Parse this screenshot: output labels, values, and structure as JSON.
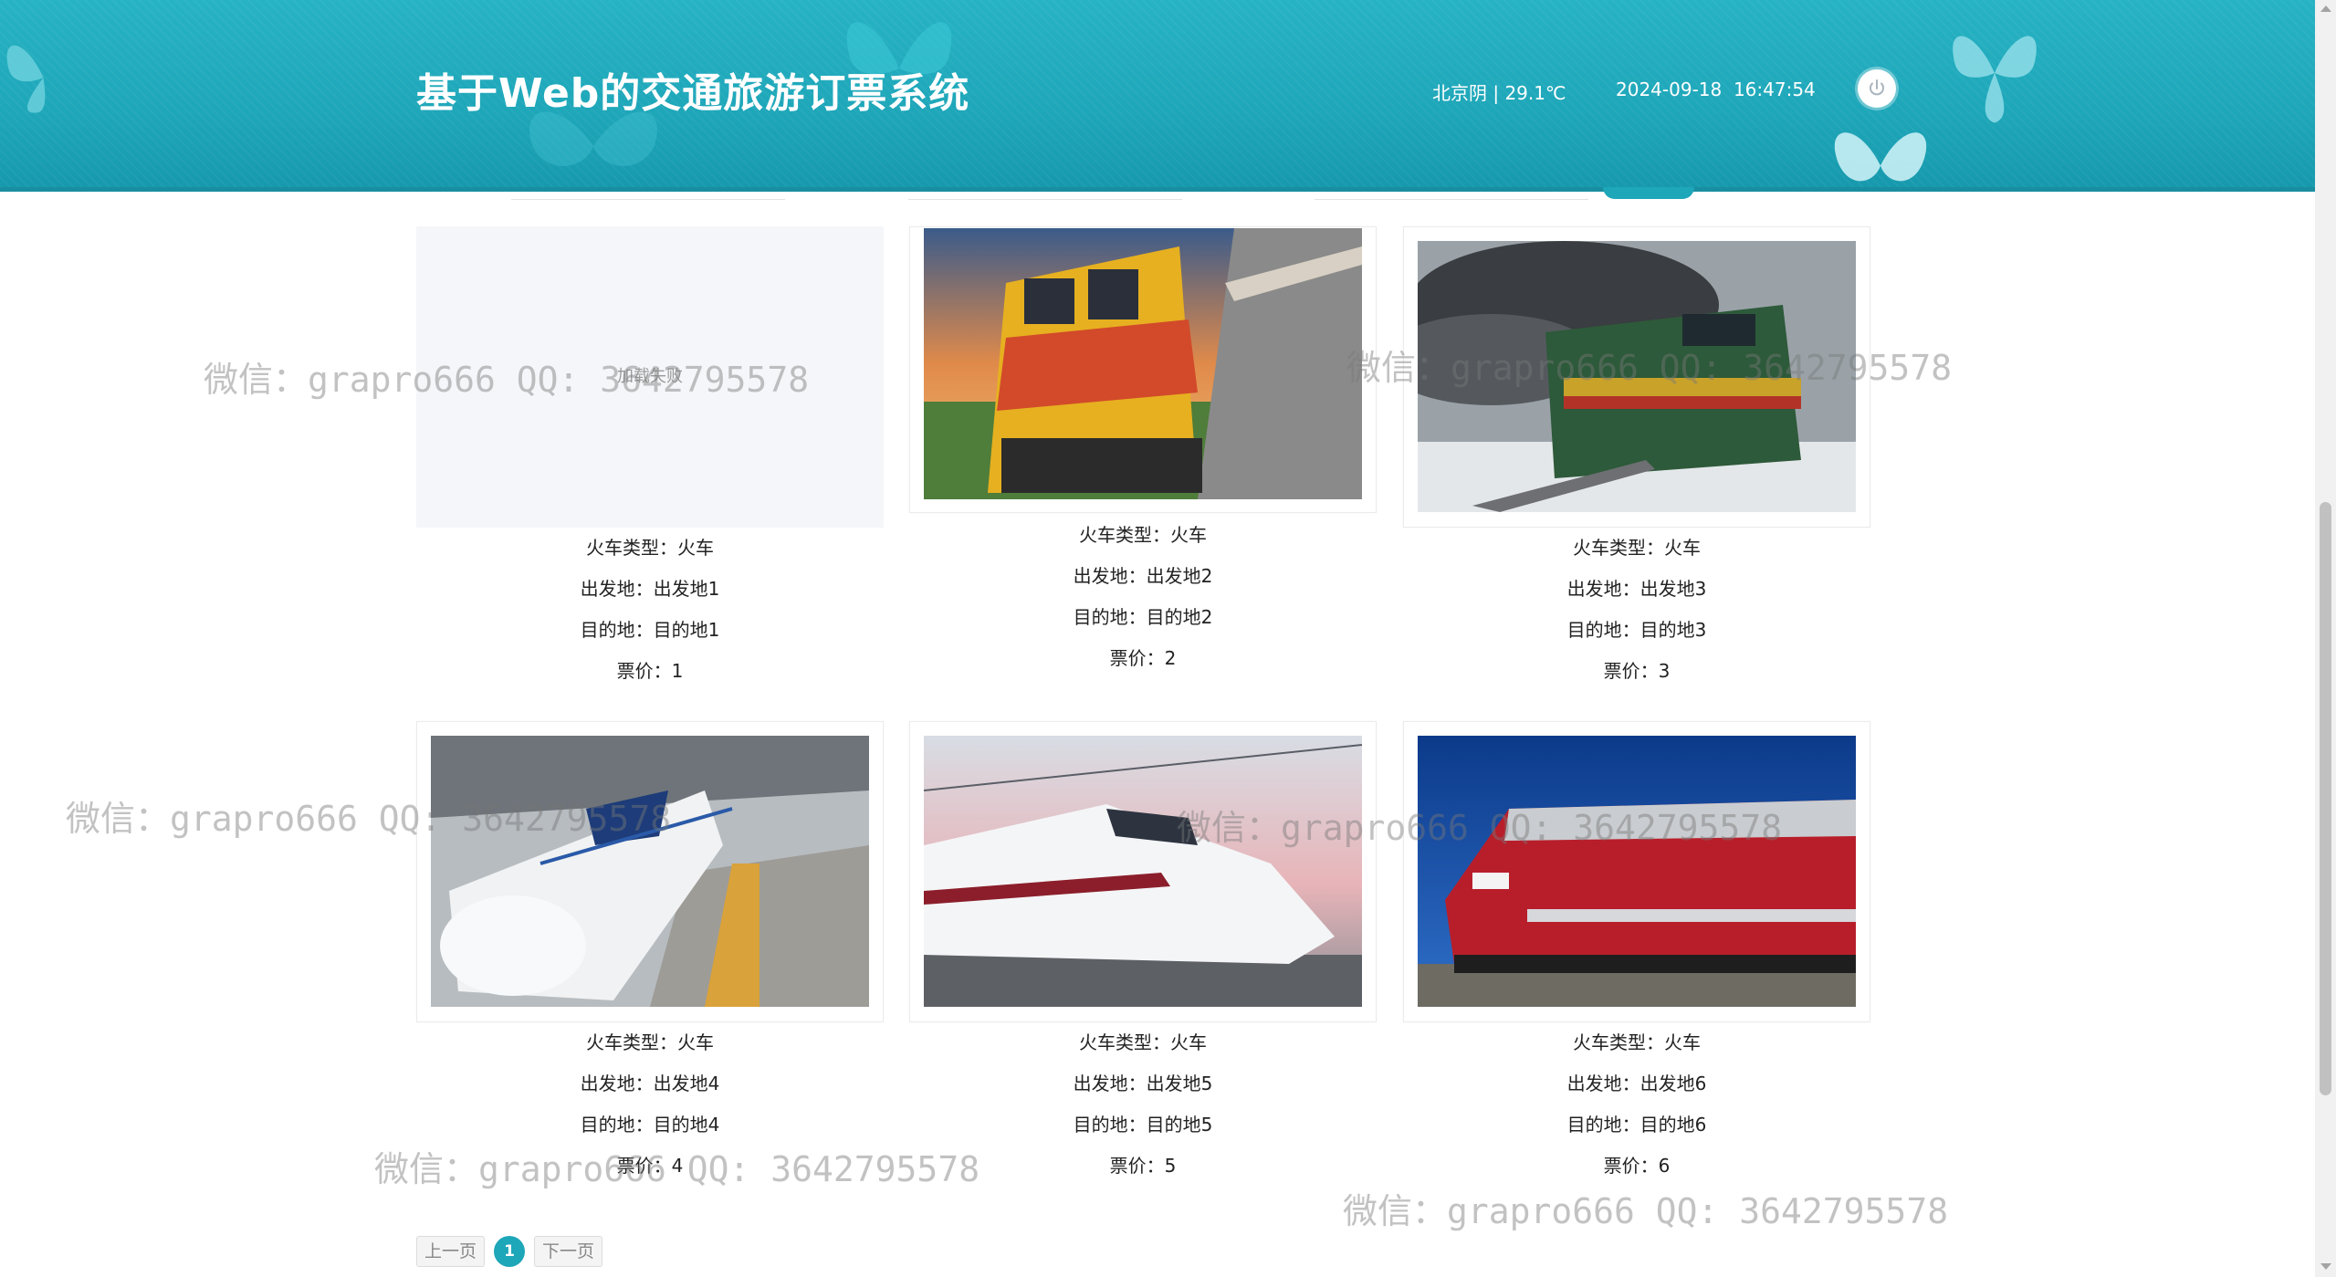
{
  "header": {
    "title": "基于Web的交通旅游订票系统",
    "weather": "北京阴 | 29.1℃",
    "date": "2024-09-18",
    "time": "16:47:54",
    "power_icon": "power-icon",
    "bg_color": "#1ea6b9"
  },
  "trains": [
    {
      "type_label": "火车类型：火车",
      "from_label": "出发地：出发地1",
      "to_label": "目的地：目的地1",
      "price_label": "票价：1",
      "image": "failed",
      "failed_text": "加载失败"
    },
    {
      "type_label": "火车类型：火车",
      "from_label": "出发地：出发地2",
      "to_label": "目的地：目的地2",
      "price_label": "票价：2",
      "image": "yellow-red-diesel-locomotive"
    },
    {
      "type_label": "火车类型：火车",
      "from_label": "出发地：出发地3",
      "to_label": "目的地：目的地3",
      "price_label": "票价：3",
      "image": "green-diesel-locomotive-snow"
    },
    {
      "type_label": "火车类型：火车",
      "from_label": "出发地：出发地4",
      "to_label": "目的地：目的地4",
      "price_label": "票价：4",
      "image": "crh-high-speed-train-station"
    },
    {
      "type_label": "火车类型：火车",
      "from_label": "出发地：出发地5",
      "to_label": "目的地：目的地5",
      "price_label": "票价：5",
      "image": "white-high-speed-train-sunset"
    },
    {
      "type_label": "火车类型：火车",
      "from_label": "出发地：出发地6",
      "to_label": "目的地：目的地6",
      "price_label": "票价：6",
      "image": "red-silver-wisconsin-locomotive"
    }
  ],
  "pagination": {
    "prev_label": "上一页",
    "current_page": "1",
    "next_label": "下一页",
    "accent_color": "#1ea6b9"
  },
  "watermark": {
    "text": "微信：grapro666 QQ: 3642795578"
  }
}
